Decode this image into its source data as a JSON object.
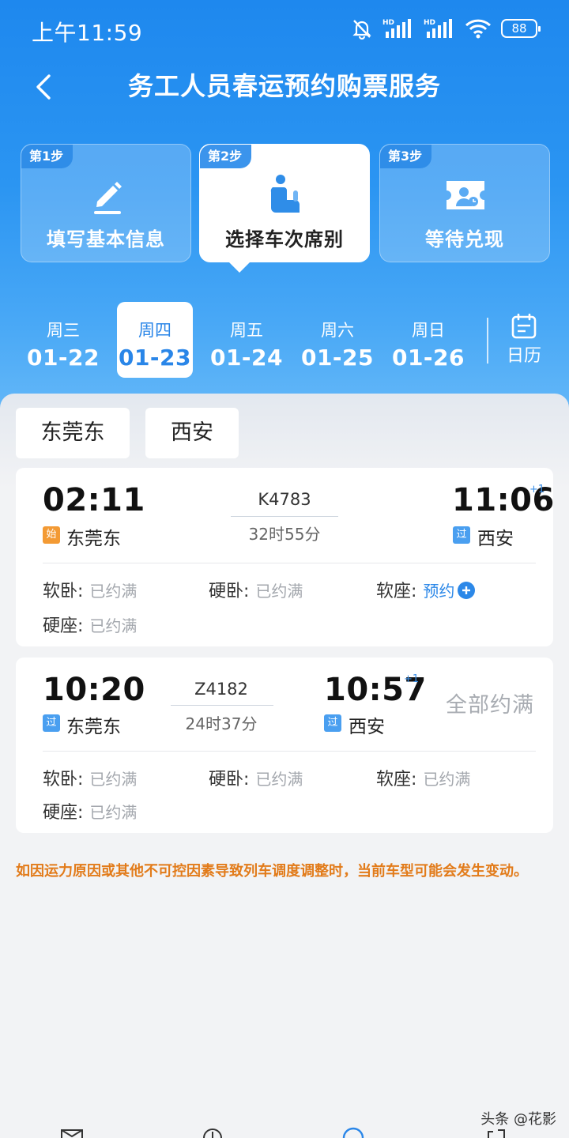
{
  "status_bar": {
    "time": "上午11:59",
    "battery": "88",
    "signal_label": "HD"
  },
  "header": {
    "title": "务工人员春运预约购票服务",
    "back_icon": "chevron-left-icon"
  },
  "steps": [
    {
      "badge": "第1步",
      "label": "填写基本信息",
      "icon": "pencil-icon",
      "active": false
    },
    {
      "badge": "第2步",
      "label": "选择车次席别",
      "icon": "seat-icon",
      "active": true
    },
    {
      "badge": "第3步",
      "label": "等待兑现",
      "icon": "ticket-icon",
      "active": false
    }
  ],
  "dates": [
    {
      "week": "周三",
      "day": "01-22",
      "active": false
    },
    {
      "week": "周四",
      "day": "01-23",
      "active": true
    },
    {
      "week": "周五",
      "day": "01-24",
      "active": false
    },
    {
      "week": "周六",
      "day": "01-25",
      "active": false
    },
    {
      "week": "周日",
      "day": "01-26",
      "active": false
    }
  ],
  "calendar": {
    "label": "日历",
    "icon": "calendar-icon"
  },
  "route": {
    "from": "东莞东",
    "to": "西安"
  },
  "trains": [
    {
      "number": "K4783",
      "depart_time": "02:11",
      "depart_tag": "始",
      "depart_station": "东莞东",
      "duration": "32时55分",
      "arrive_time": "11:06",
      "arrive_plus": "+1",
      "arrive_tag": "过",
      "arrive_station": "西安",
      "seats": [
        {
          "type": "软卧:",
          "status": "已约满"
        },
        {
          "type": "硬卧:",
          "status": "已约满"
        },
        {
          "type": "软座:",
          "status": "预约"
        },
        {
          "type": "硬座:",
          "status": "已约满"
        }
      ]
    },
    {
      "number": "Z4182",
      "depart_time": "10:20",
      "depart_tag": "过",
      "depart_station": "东莞东",
      "duration": "24时37分",
      "arrive_time": "10:57",
      "arrive_plus": "+1",
      "arrive_tag": "过",
      "arrive_station": "西安",
      "overall_status": "全部约满",
      "seats": [
        {
          "type": "软卧:",
          "status": "已约满"
        },
        {
          "type": "硬卧:",
          "status": "已约满"
        },
        {
          "type": "软座:",
          "status": "已约满"
        },
        {
          "type": "硬座:",
          "status": "已约满"
        }
      ]
    }
  ],
  "notice": "如因运力原因或其他不可控因素导致列车调度调整时，当前车型可能会发生变动。",
  "watermark": "头条 @花影",
  "colors": {
    "primary": "#2a86e8",
    "notice": "#e27b1a",
    "start_tag": "#f39a34",
    "pass_tag": "#4a9ff0",
    "muted": "#a3a7ad"
  }
}
